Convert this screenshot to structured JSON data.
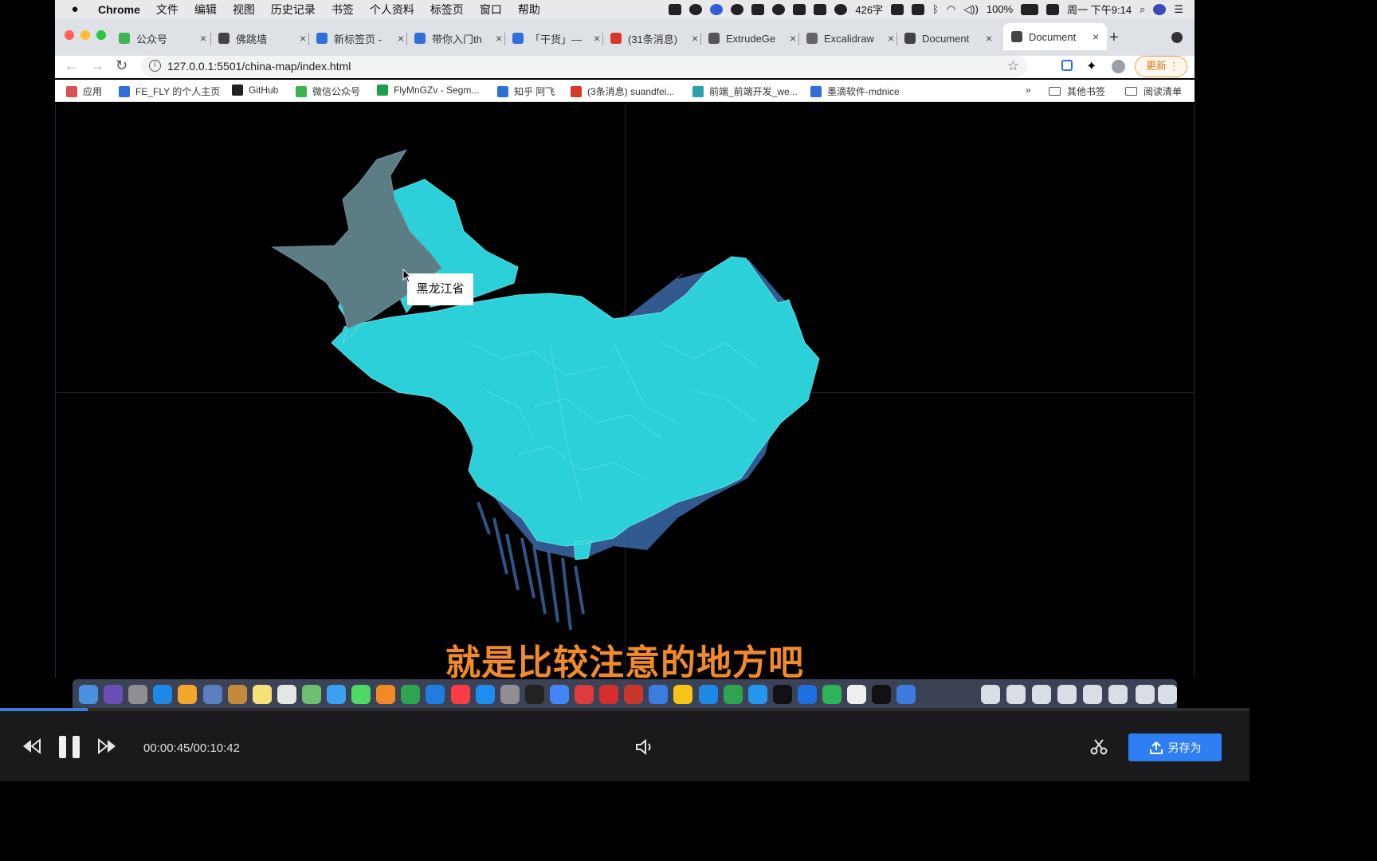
{
  "menubar": {
    "app_name": "Chrome",
    "menus": [
      "文件",
      "编辑",
      "视图",
      "历史记录",
      "书签",
      "个人资料",
      "标签页",
      "窗口",
      "帮助"
    ],
    "word_count": "426字",
    "battery": "100%",
    "clock": "周一 下午9:14"
  },
  "tabs": [
    {
      "label": "公众号",
      "color": "#3fb34f"
    },
    {
      "label": "佛跳墙",
      "color": "#444444"
    },
    {
      "label": "新标签页 -",
      "color": "#2f6fd8"
    },
    {
      "label": "带你入门th",
      "color": "#2f6fd8"
    },
    {
      "label": "「干货」—",
      "color": "#2f6fd8"
    },
    {
      "label": "(31条消息)",
      "color": "#d43a2a"
    },
    {
      "label": "ExtrudeGe",
      "color": "#555555"
    },
    {
      "label": "Excalidraw",
      "color": "#666666"
    },
    {
      "label": "Document",
      "color": "#444444"
    },
    {
      "label": "Document",
      "color": "#444444",
      "active": true
    }
  ],
  "address": {
    "url": "127.0.0.1:5501/china-map/index.html",
    "update_label": "更新"
  },
  "bookmarks": [
    {
      "label": "应用",
      "color": "#d9534f"
    },
    {
      "label": "FE_FLY 的个人主页",
      "color": "#2f6fd8"
    },
    {
      "label": "GitHub",
      "color": "#222222"
    },
    {
      "label": "微信公众号",
      "color": "#3fb34f"
    },
    {
      "label": "FlyMnGZv - Segm...",
      "color": "#1e9e4a"
    },
    {
      "label": "知乎 阿飞",
      "color": "#2f6fd8"
    },
    {
      "label": "(3条消息) suandfei...",
      "color": "#d43a2a"
    },
    {
      "label": "前端_前端开发_we...",
      "color": "#2aa0a8"
    },
    {
      "label": "墨滴软件-mdnice",
      "color": "#2f6fd8"
    }
  ],
  "bookmarks_right": {
    "more": "»",
    "other": "其他书签",
    "reading": "阅读清单"
  },
  "map": {
    "tooltip": "黑龙江省",
    "fill": "#2bd0d8",
    "highlight": "#5c7c86",
    "extrude": "#3c6aa8"
  },
  "subtitle": "就是比较注意的地方吧",
  "player": {
    "time": "00:00:45/00:10:42",
    "progress": 0.07,
    "save_label": "另存为"
  },
  "dock_apps": [
    "finder-icon",
    "siri-icon",
    "launchpad-icon",
    "safari-icon",
    "photos-icon",
    "preview-icon",
    "notes-icon",
    "reminders-icon",
    "maps-icon",
    "messages-icon",
    "facetime-icon",
    "pages-icon",
    "numbers-icon",
    "keynote-icon",
    "music-icon",
    "appstore-icon",
    "settings-icon",
    "terminal-icon",
    "chrome-icon",
    "netease-music-icon",
    "xmind-icon",
    "wps-icon",
    "baidu-disk-icon",
    "qq-music-icon",
    "vscode-icon",
    "wechat-icon",
    "docker-icon",
    "iterm-icon",
    "uc-icon",
    "wechat-work-icon",
    "typora-icon",
    "capcut-icon",
    "edge-icon",
    "sourcetree-icon"
  ]
}
